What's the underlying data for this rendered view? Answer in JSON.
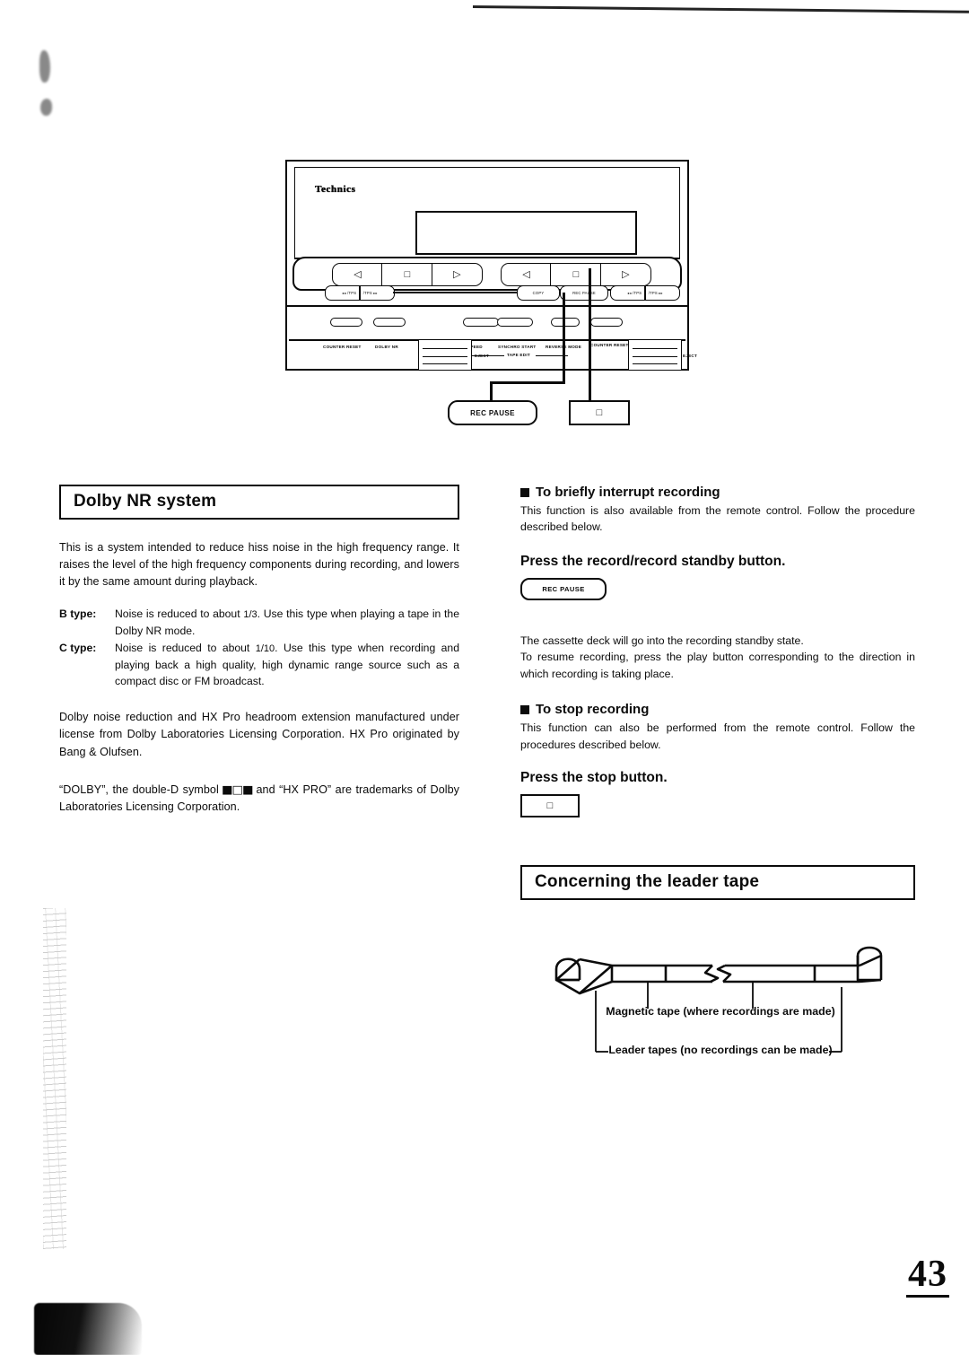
{
  "page": {
    "number": "43"
  },
  "figure_deck": {
    "brand": "Technics",
    "transport_left": [
      "◁",
      "□",
      "▷"
    ],
    "transport_right": [
      "◁",
      "□",
      "▷"
    ],
    "mini_buttons": {
      "deck1_rew": "◂◂ /TPS",
      "deck1_ff": "/TPS ▸▸",
      "copy": "COPY",
      "rec_pause": "REC PAUSE",
      "deck2_rew": "◂◂ /TPS",
      "deck2_ff": "/TPS ▸▸"
    },
    "panel_labels": {
      "counter_reset_left": "COUNTER RESET",
      "dolby_nr": "DOLBY NR",
      "eject_left": "EJECT",
      "speed": "SPEED",
      "synchro_start": "SYNCHRO START",
      "tape_edit": "TAPE EDIT",
      "reverse_mode": "REVERSE MODE",
      "counter_reset_right": "COUNTER RESET",
      "eject_right": "EJECT"
    },
    "callouts": {
      "rec_pause": "REC PAUSE",
      "stop": "□"
    }
  },
  "left_column": {
    "heading": "Dolby NR system",
    "intro": "This is a system intended to reduce hiss noise in the high frequency range. It raises the level of the high frequency components during recording, and lowers it by the same amount during playback.",
    "types": [
      {
        "term": "B type:",
        "desc_pre": "Noise is reduced to about ",
        "fraction": "1/3",
        "desc_post": ". Use this type when playing a tape in the Dolby NR mode."
      },
      {
        "term": "C type:",
        "desc_pre": "Noise is reduced to about ",
        "fraction": "1/10",
        "desc_post": ". Use this type when recording and playing back a high quality, high dynamic range source such as a compact disc or FM broadcast."
      }
    ],
    "license": "Dolby noise reduction and HX Pro headroom extension manufactured under license from Dolby Laboratories Licensing Corporation. HX Pro originated by Bang & Olufsen.",
    "trademark_pre": "“DOLBY”, the double-D symbol ",
    "trademark_symbol": "■□■",
    "trademark_post": " and “HX PRO” are trademarks of Dolby Laboratories Licensing Corporation."
  },
  "right_column": {
    "section1": {
      "heading": "To briefly interrupt recording",
      "body": "This function is also available from the remote control. Follow the procedure described below.",
      "step": "Press the record/record standby button.",
      "button_label": "REC PAUSE",
      "result": "The cassette deck will go into the recording standby state.\nTo resume recording, press the play button corresponding to the direction in which recording is taking place."
    },
    "section2": {
      "heading": "To stop recording",
      "body": "This function can also be performed from the remote control. Follow the procedures described below.",
      "step": "Press the stop button.",
      "button_label": "□"
    },
    "section3": {
      "heading": "Concerning the leader tape",
      "label_magnetic": "Magnetic tape (where recordings are made)",
      "label_leader": "Leader tapes (no recordings can be made)"
    }
  }
}
